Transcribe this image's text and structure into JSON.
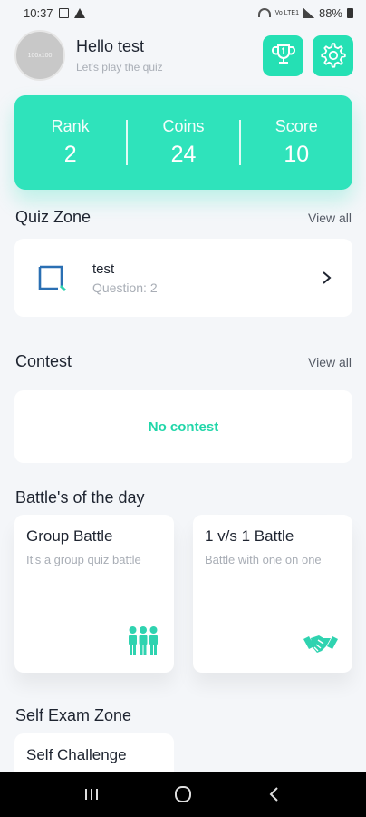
{
  "status_bar": {
    "time": "10:37",
    "lte_label": "Vo LTE1",
    "battery": "88%"
  },
  "header": {
    "avatar_text": "100x100",
    "greeting": "Hello test",
    "subtitle": "Let's play the quiz",
    "trophy_icon": "trophy-icon",
    "settings_icon": "gear-icon"
  },
  "stats": [
    {
      "label": "Rank",
      "value": "2"
    },
    {
      "label": "Coins",
      "value": "24"
    },
    {
      "label": "Score",
      "value": "10"
    }
  ],
  "quiz_zone": {
    "title": "Quiz Zone",
    "view_all": "View all",
    "item": {
      "name": "test",
      "questions": "Question: 2"
    }
  },
  "contest": {
    "title": "Contest",
    "view_all": "View all",
    "empty": "No contest"
  },
  "battles": {
    "title": "Battle's of the day",
    "items": [
      {
        "title": "Group Battle",
        "desc": "It's a group quiz battle",
        "icon": "group-icon"
      },
      {
        "title": "1 v/s 1 Battle",
        "desc": "Battle with one on one",
        "icon": "handshake-icon"
      }
    ]
  },
  "self_exam": {
    "title": "Self Exam Zone",
    "card_title": "Self Challenge"
  },
  "colors": {
    "accent": "#2fe3bb",
    "accent_dark": "#21d6a9",
    "background": "#f4f6f9"
  }
}
